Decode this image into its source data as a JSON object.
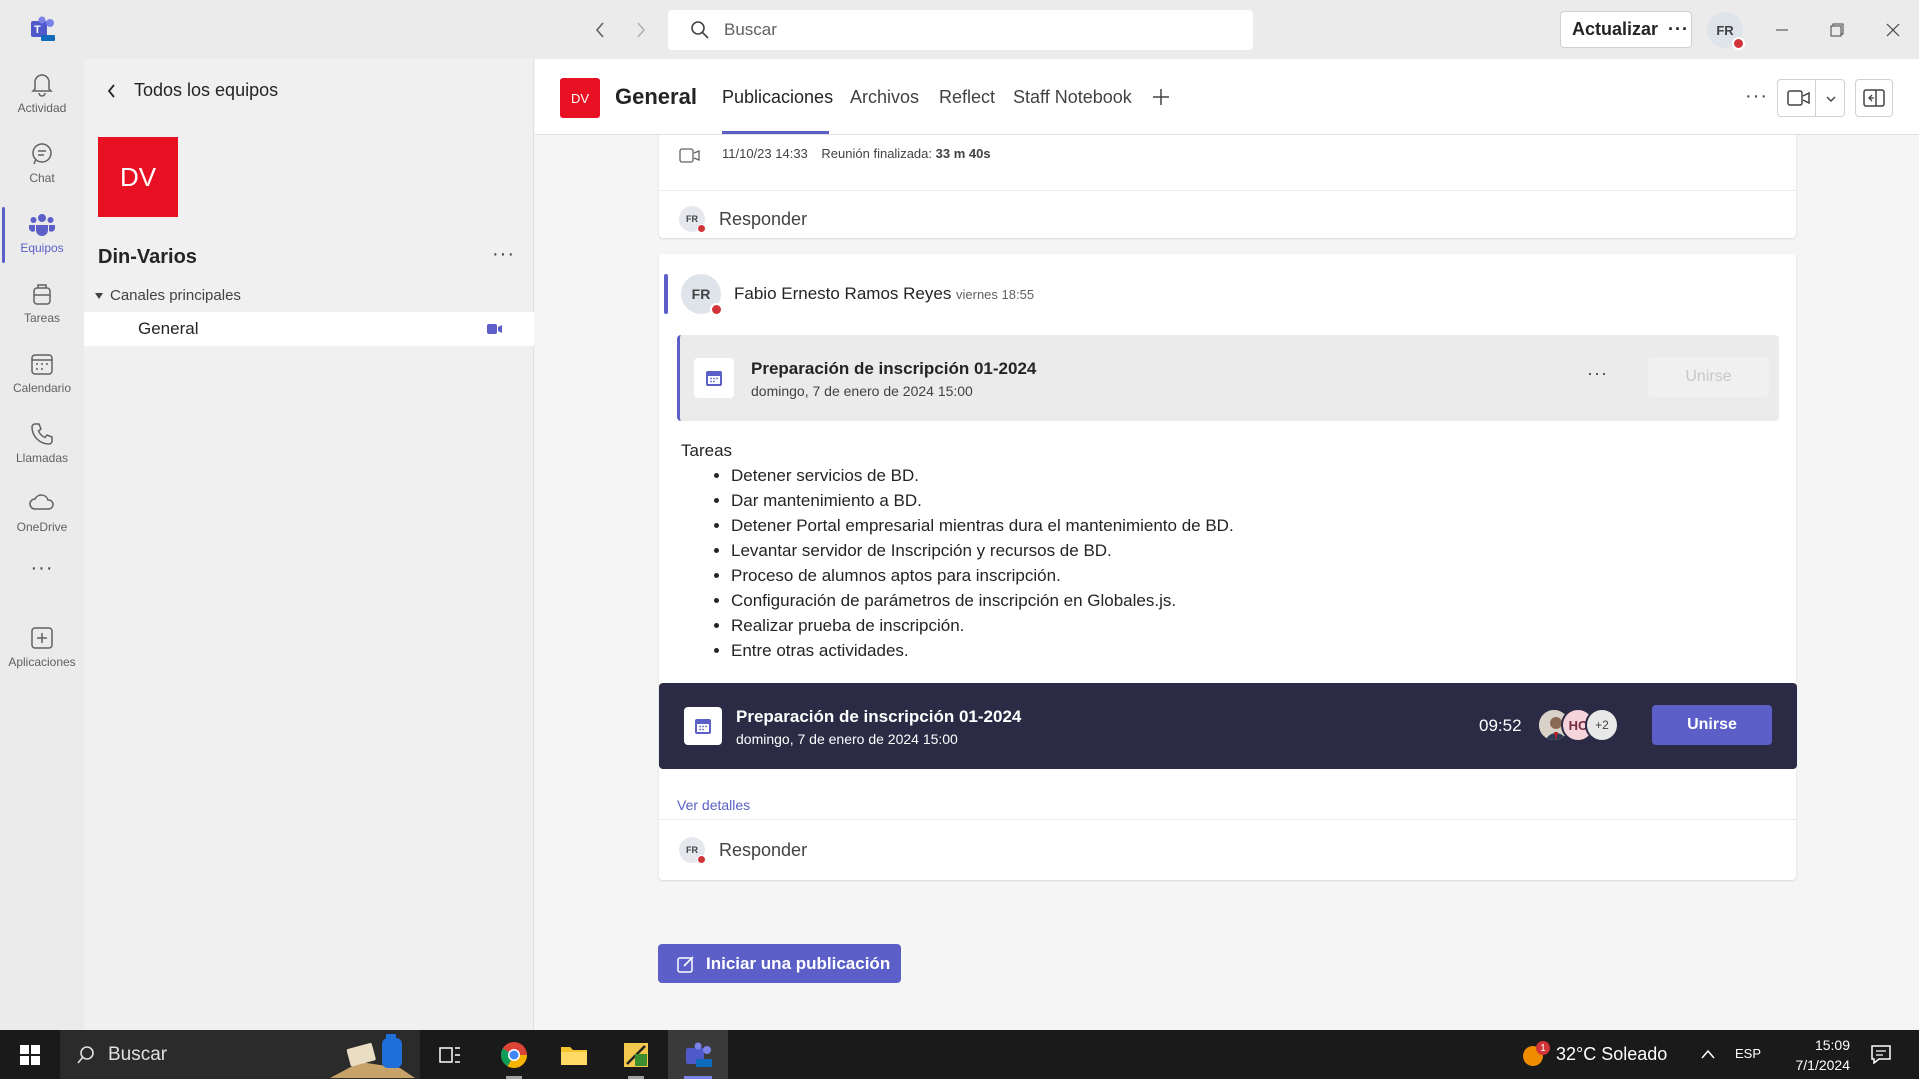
{
  "titlebar": {
    "search_placeholder": "Buscar",
    "update_label": "Actualizar",
    "more_glyph": "···",
    "user_initials": "FR"
  },
  "rail": {
    "items": [
      {
        "label": "Actividad",
        "icon": "bell-icon"
      },
      {
        "label": "Chat",
        "icon": "chat-icon"
      },
      {
        "label": "Equipos",
        "icon": "teams-icon"
      },
      {
        "label": "Tareas",
        "icon": "tasks-icon"
      },
      {
        "label": "Calendario",
        "icon": "calendar-icon"
      },
      {
        "label": "Llamadas",
        "icon": "phone-icon"
      },
      {
        "label": "OneDrive",
        "icon": "cloud-icon"
      },
      {
        "label": "Aplicaciones",
        "icon": "add-apps-icon"
      }
    ],
    "more_glyph": "···",
    "active_index": 2
  },
  "teampanel": {
    "back_label": "Todos los equipos",
    "team_initials": "DV",
    "team_name": "Din-Varios",
    "more_glyph": "···",
    "channels_header": "Canales principales",
    "channels": [
      {
        "name": "General"
      }
    ]
  },
  "channel_header": {
    "logo_initials": "DV",
    "title": "General",
    "tabs": [
      {
        "label": "Publicaciones",
        "active": true
      },
      {
        "label": "Archivos"
      },
      {
        "label": "Reflect"
      },
      {
        "label": "Staff Notebook"
      }
    ],
    "more_glyph": "···"
  },
  "feed": {
    "prev_post": {
      "date": "11/10/23 14:33",
      "ended_label": "Reunión finalizada:",
      "duration": "33 m 40s",
      "reply_initials": "FR",
      "reply_label": "Responder"
    },
    "post": {
      "author_initials": "FR",
      "author": "Fabio Ernesto Ramos Reyes",
      "time": "viernes 18:55",
      "meeting_title": "Preparación de inscripción 01-2024",
      "meeting_date": "domingo, 7 de enero de 2024 15:00",
      "meeting_more": "···",
      "meeting_join_disabled": "Unirse",
      "tasks_heading": "Tareas",
      "tasks": [
        "Detener servicios de BD.",
        "Dar mantenimiento a BD.",
        "Detener Portal empresarial mientras dura el mantenimiento de BD.",
        "Levantar servidor de Inscripción y recursos de BD.",
        "Proceso de alumnos aptos para inscripción.",
        "Configuración de parámetros de inscripción en Globales.js.",
        "Realizar prueba de inscripción.",
        "Entre otras actividades."
      ],
      "banner": {
        "title": "Preparación de inscripción 01-2024",
        "date": "domingo, 7 de enero de 2024 15:00",
        "timer": "09:52",
        "participant_initials": "HC",
        "participant_more": "+2",
        "join_label": "Unirse"
      },
      "details_link": "Ver detalles",
      "reply_initials": "FR",
      "reply_label": "Responder"
    },
    "new_post_label": "Iniciar una publicación"
  },
  "taskbar": {
    "search_label": "Buscar",
    "weather": "32°C Soleado",
    "weather_badge": "1",
    "lang": "ESP",
    "time": "15:09",
    "date": "7/1/2024"
  },
  "colors": {
    "accent": "#5b5fc7",
    "team_red": "#e81123",
    "banner_bg": "#2b2b45",
    "presence_busy": "#d13438"
  }
}
